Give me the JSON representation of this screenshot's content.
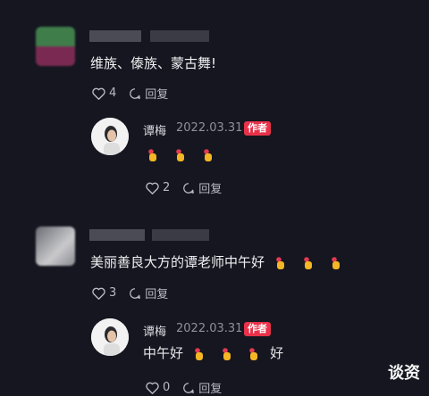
{
  "comments": [
    {
      "text": "维族、傣族、蒙古舞!",
      "likes": "4",
      "reply_label": "回复",
      "reply": {
        "author": "谭梅",
        "date": "2022.03.31",
        "badge": "作者",
        "likes": "2",
        "reply_label": "回复"
      }
    },
    {
      "text": "美丽善良大方的谭老师中午好",
      "likes": "3",
      "reply_label": "回复",
      "reply": {
        "author": "谭梅",
        "date": "2022.03.31",
        "badge": "作者",
        "text": "中午好",
        "text_suffix": "好",
        "likes": "0",
        "reply_label": "回复"
      }
    }
  ],
  "watermark": "谈资",
  "icons": [
    "heart-icon",
    "reply-bubble-icon",
    "fingers-heart-emoji"
  ],
  "colors": {
    "background": "#151620",
    "author_badge": "#e8324a"
  }
}
